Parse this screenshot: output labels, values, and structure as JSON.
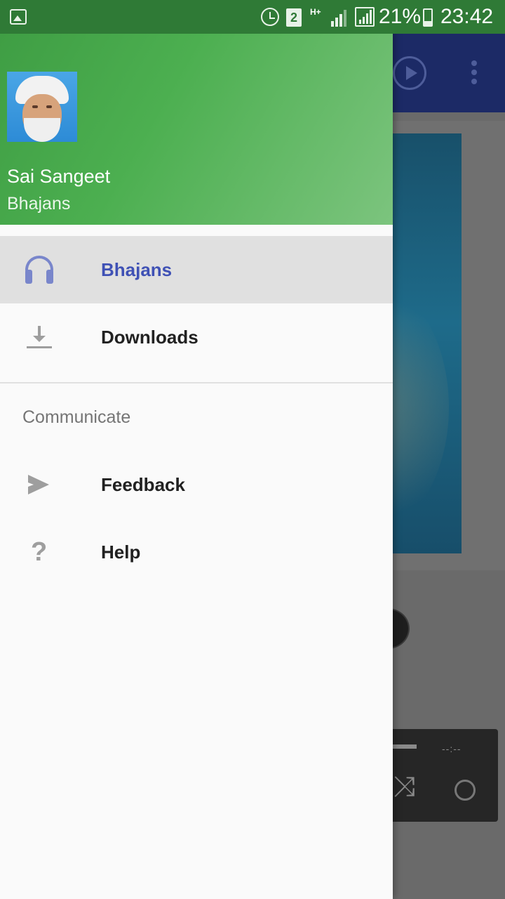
{
  "status_bar": {
    "network_type": "H+",
    "sim_slot": "2",
    "battery_percent": "21%",
    "time": "23:42",
    "icons": [
      "gallery-icon",
      "alarm-icon",
      "sim-icon",
      "signal-icon",
      "signal-icon",
      "battery-icon"
    ]
  },
  "drawer": {
    "header": {
      "app_title": "Sai Sangeet",
      "subtitle": "Bhajans"
    },
    "items": [
      {
        "label": "Bhajans",
        "icon": "headphones-icon",
        "selected": true
      },
      {
        "label": "Downloads",
        "icon": "download-icon",
        "selected": false
      }
    ],
    "section_communicate": {
      "title": "Communicate",
      "items": [
        {
          "label": "Feedback",
          "icon": "send-icon"
        },
        {
          "label": "Help",
          "icon": "help-icon"
        }
      ]
    }
  },
  "background_app": {
    "toolbar_icons": [
      "play-icon",
      "more-vert-icon"
    ],
    "player_time": "--:--",
    "player_icons": [
      "shuffle-icon",
      "repeat-icon"
    ]
  },
  "colors": {
    "status_bar": "#2f7a36",
    "header_gradient_start": "#3f9e44",
    "header_gradient_end": "#7cc47e",
    "selected_accent": "#3f51b5",
    "selected_row_bg": "#e0e0e0",
    "icon_grey": "#9e9e9e"
  }
}
